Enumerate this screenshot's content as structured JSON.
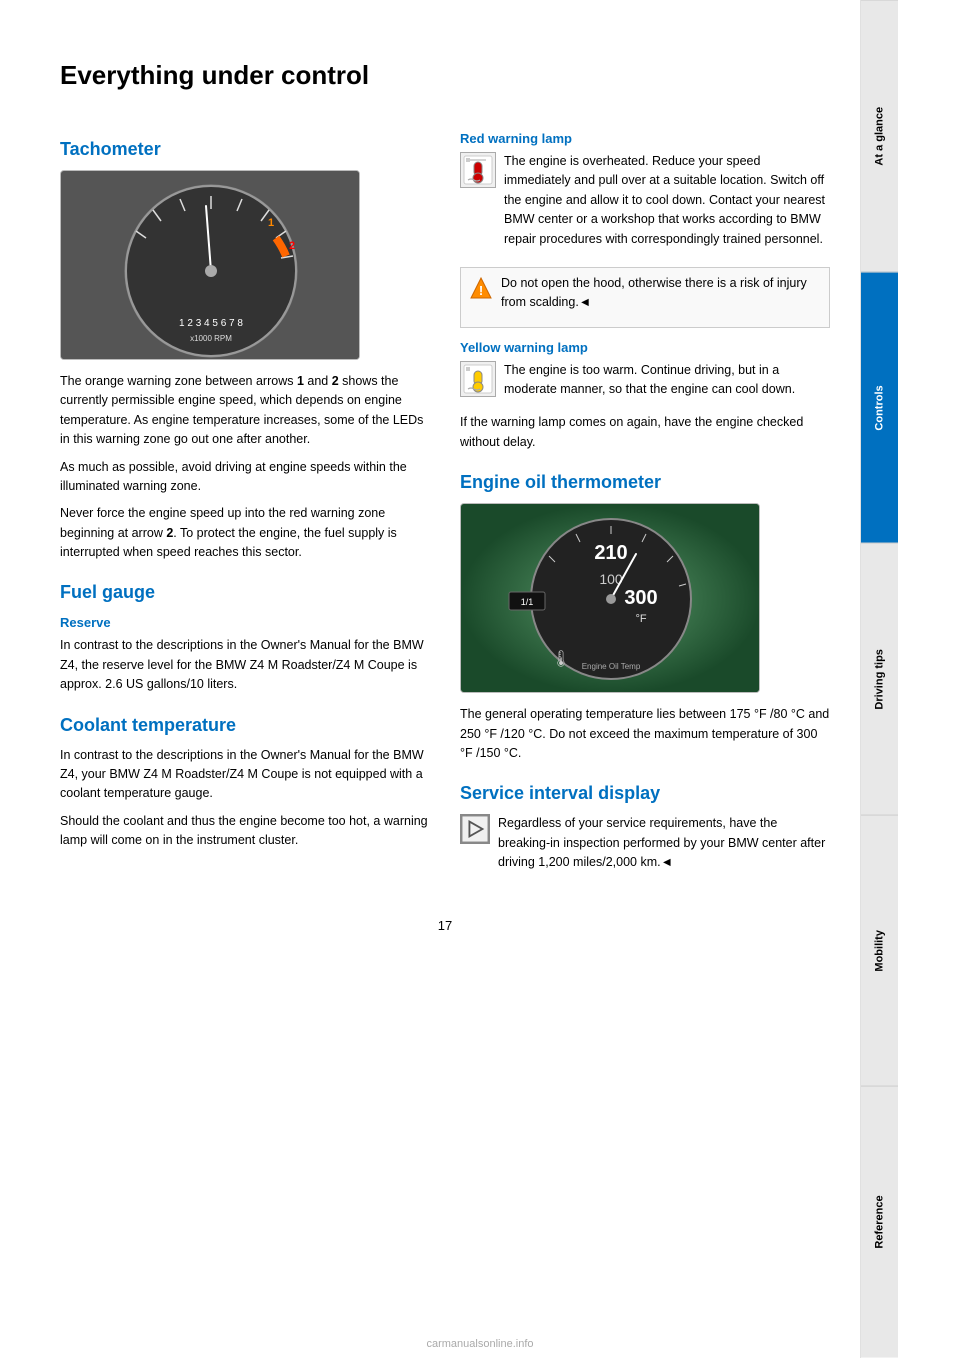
{
  "page": {
    "title": "Everything under control",
    "page_number": "17",
    "watermark": "carmanualsonline.info"
  },
  "sidebar": {
    "tabs": [
      {
        "id": "at-a-glance",
        "label": "At a glance",
        "active": false
      },
      {
        "id": "controls",
        "label": "Controls",
        "active": true
      },
      {
        "id": "driving-tips",
        "label": "Driving tips",
        "active": false
      },
      {
        "id": "mobility",
        "label": "Mobility",
        "active": false
      },
      {
        "id": "reference",
        "label": "Reference",
        "active": false
      }
    ]
  },
  "sections": {
    "tachometer": {
      "title": "Tachometer",
      "body1": "The orange warning zone between arrows 1 and 2 shows the currently permissible engine speed, which depends on engine temperature. As engine temperature increases, some of the LEDs in this warning zone go out one after another.",
      "body2": "As much as possible, avoid driving at engine speeds within the illuminated warning zone.",
      "body3": "Never force the engine speed up into the red warning zone beginning at arrow 2. To protect the engine, the fuel supply is interrupted when speed reaches this sector."
    },
    "fuel_gauge": {
      "title": "Fuel gauge",
      "reserve_title": "Reserve",
      "reserve_body": "In contrast to the descriptions in the Owner's Manual for the BMW Z4, the reserve level for the BMW Z4 M Roadster/Z4 M Coupe is approx. 2.6 US gallons/10 liters."
    },
    "coolant": {
      "title": "Coolant temperature",
      "body1": "In contrast to the descriptions in the Owner's Manual for the BMW Z4, your BMW Z4 M Roadster/Z4 M Coupe is not equipped with a coolant temperature gauge.",
      "body2": "Should the coolant and thus the engine become too hot, a warning lamp will come on in the instrument cluster."
    },
    "red_warning": {
      "title": "Red warning lamp",
      "body": "The engine is overheated. Reduce your speed immediately and pull over at a suitable location. Switch off the engine and allow it to cool down. Contact your nearest BMW center or a workshop that works according to BMW repair procedures with correspondingly trained personnel.",
      "warning_note": "Do not open the hood, otherwise there is a risk of injury from scalding."
    },
    "yellow_warning": {
      "title": "Yellow warning lamp",
      "body": "The engine is too warm. Continue driving, but in a moderate manner, so that the engine can cool down.",
      "follow_up": "If the warning lamp comes on again, have the engine checked without delay."
    },
    "oil_thermo": {
      "title": "Engine oil thermometer",
      "value1": "210",
      "value2": "300",
      "date_display": "1/1",
      "body": "The general operating temperature lies between 175 °F /80 °C and 250 °F /120 °C. Do not exceed the maximum temperature of 300 °F /150 °C."
    },
    "service_interval": {
      "title": "Service interval display",
      "body": "Regardless of your service requirements, have the breaking-in inspection performed by your BMW center after driving 1,200 miles/2,000 km."
    }
  }
}
